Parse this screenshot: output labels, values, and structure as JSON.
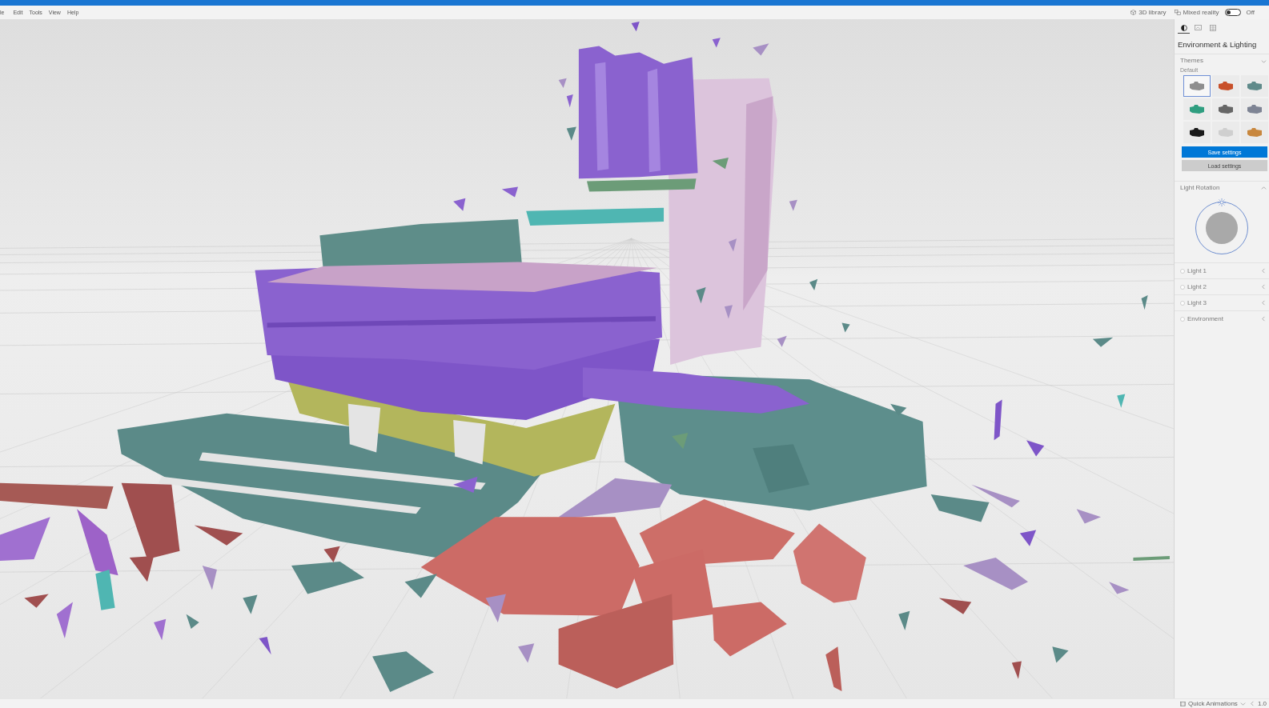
{
  "menu_bar": {
    "items": [
      "le",
      "Edit",
      "Tools",
      "View",
      "Help"
    ]
  },
  "toolbar": {
    "library_label": "3D library",
    "mixed_reality": {
      "label": "Mixed reality",
      "on": false,
      "state_text": "Off"
    }
  },
  "panel": {
    "tabs": [
      {
        "selected": true
      },
      {
        "selected": false
      },
      {
        "selected": false
      }
    ],
    "title": "Environment & Lighting",
    "themes": {
      "heading": "Themes",
      "group_label": "Default",
      "items": [
        {
          "color": "#8e8e8e",
          "selected": true
        },
        {
          "color": "#c8502a",
          "selected": false
        },
        {
          "color": "#5f8a8a",
          "selected": false
        },
        {
          "color": "#2f9e80",
          "selected": false
        },
        {
          "color": "#666666",
          "selected": false
        },
        {
          "color": "#7e8494",
          "selected": false
        },
        {
          "color": "#1a1a1a",
          "selected": false
        },
        {
          "color": "#cfcfcf",
          "selected": false
        },
        {
          "color": "#c8873e",
          "selected": false
        }
      ]
    },
    "save_button": "Save settings",
    "load_button": "Load settings",
    "light_rotation": {
      "heading": "Light Rotation"
    },
    "lights": [
      {
        "label": "Light 1"
      },
      {
        "label": "Light 2"
      },
      {
        "label": "Light 3"
      },
      {
        "label": "Environment"
      }
    ]
  },
  "status_bar": {
    "animations_label": "Quick Animations",
    "speed": "1.0"
  }
}
